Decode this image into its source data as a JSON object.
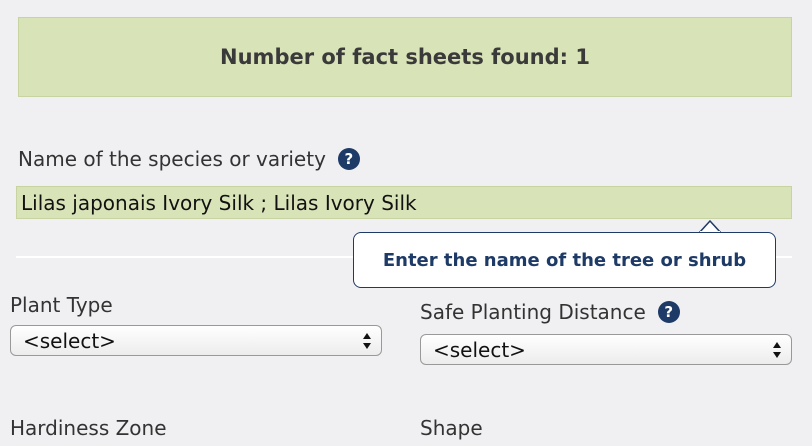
{
  "results": {
    "count_text": "Number of fact sheets found: 1"
  },
  "species": {
    "label": "Name of the species or variety",
    "help_icon": "?",
    "value": "Lilas japonais Ivory Silk ; Lilas Ivory Silk",
    "tooltip": "Enter the name of the tree or shrub"
  },
  "filters": {
    "plant_type": {
      "label": "Plant Type",
      "selected": "<select>"
    },
    "safe_planting_distance": {
      "label": "Safe Planting Distance",
      "help_icon": "?",
      "selected": "<select>"
    },
    "hardiness_zone": {
      "label": "Hardiness Zone"
    },
    "shape": {
      "label": "Shape"
    }
  },
  "colors": {
    "banner_bg": "#d9e3b8",
    "accent_navy": "#1e3a66",
    "page_bg": "#f0f0f3"
  }
}
